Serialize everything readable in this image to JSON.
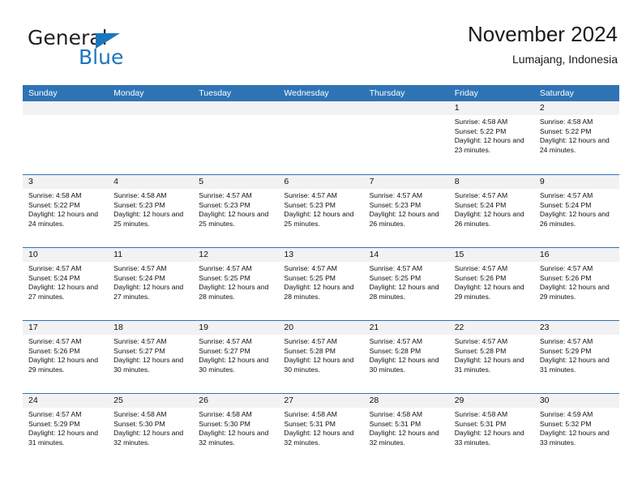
{
  "brand": {
    "name_top": "General",
    "name_bottom": "Blue",
    "triangle_icon": "triangle-icon",
    "color": "#1b76bc"
  },
  "header": {
    "title": "November 2024",
    "location": "Lumajang, Indonesia"
  },
  "theme": {
    "header_blue": "#2e74b5",
    "day_number_bg": "#f2f2f2"
  },
  "weekdays": [
    "Sunday",
    "Monday",
    "Tuesday",
    "Wednesday",
    "Thursday",
    "Friday",
    "Saturday"
  ],
  "labels": {
    "sunrise": "Sunrise:",
    "sunset": "Sunset:",
    "daylight": "Daylight:"
  },
  "weeks": [
    [
      {
        "day": "",
        "empty": true
      },
      {
        "day": "",
        "empty": true
      },
      {
        "day": "",
        "empty": true
      },
      {
        "day": "",
        "empty": true
      },
      {
        "day": "",
        "empty": true
      },
      {
        "day": "1",
        "sunrise": "Sunrise: 4:58 AM",
        "sunset": "Sunset: 5:22 PM",
        "daylight": "Daylight: 12 hours and 23 minutes."
      },
      {
        "day": "2",
        "sunrise": "Sunrise: 4:58 AM",
        "sunset": "Sunset: 5:22 PM",
        "daylight": "Daylight: 12 hours and 24 minutes."
      }
    ],
    [
      {
        "day": "3",
        "sunrise": "Sunrise: 4:58 AM",
        "sunset": "Sunset: 5:22 PM",
        "daylight": "Daylight: 12 hours and 24 minutes."
      },
      {
        "day": "4",
        "sunrise": "Sunrise: 4:58 AM",
        "sunset": "Sunset: 5:23 PM",
        "daylight": "Daylight: 12 hours and 25 minutes."
      },
      {
        "day": "5",
        "sunrise": "Sunrise: 4:57 AM",
        "sunset": "Sunset: 5:23 PM",
        "daylight": "Daylight: 12 hours and 25 minutes."
      },
      {
        "day": "6",
        "sunrise": "Sunrise: 4:57 AM",
        "sunset": "Sunset: 5:23 PM",
        "daylight": "Daylight: 12 hours and 25 minutes."
      },
      {
        "day": "7",
        "sunrise": "Sunrise: 4:57 AM",
        "sunset": "Sunset: 5:23 PM",
        "daylight": "Daylight: 12 hours and 26 minutes."
      },
      {
        "day": "8",
        "sunrise": "Sunrise: 4:57 AM",
        "sunset": "Sunset: 5:24 PM",
        "daylight": "Daylight: 12 hours and 26 minutes."
      },
      {
        "day": "9",
        "sunrise": "Sunrise: 4:57 AM",
        "sunset": "Sunset: 5:24 PM",
        "daylight": "Daylight: 12 hours and 26 minutes."
      }
    ],
    [
      {
        "day": "10",
        "sunrise": "Sunrise: 4:57 AM",
        "sunset": "Sunset: 5:24 PM",
        "daylight": "Daylight: 12 hours and 27 minutes."
      },
      {
        "day": "11",
        "sunrise": "Sunrise: 4:57 AM",
        "sunset": "Sunset: 5:24 PM",
        "daylight": "Daylight: 12 hours and 27 minutes."
      },
      {
        "day": "12",
        "sunrise": "Sunrise: 4:57 AM",
        "sunset": "Sunset: 5:25 PM",
        "daylight": "Daylight: 12 hours and 28 minutes."
      },
      {
        "day": "13",
        "sunrise": "Sunrise: 4:57 AM",
        "sunset": "Sunset: 5:25 PM",
        "daylight": "Daylight: 12 hours and 28 minutes."
      },
      {
        "day": "14",
        "sunrise": "Sunrise: 4:57 AM",
        "sunset": "Sunset: 5:25 PM",
        "daylight": "Daylight: 12 hours and 28 minutes."
      },
      {
        "day": "15",
        "sunrise": "Sunrise: 4:57 AM",
        "sunset": "Sunset: 5:26 PM",
        "daylight": "Daylight: 12 hours and 29 minutes."
      },
      {
        "day": "16",
        "sunrise": "Sunrise: 4:57 AM",
        "sunset": "Sunset: 5:26 PM",
        "daylight": "Daylight: 12 hours and 29 minutes."
      }
    ],
    [
      {
        "day": "17",
        "sunrise": "Sunrise: 4:57 AM",
        "sunset": "Sunset: 5:26 PM",
        "daylight": "Daylight: 12 hours and 29 minutes."
      },
      {
        "day": "18",
        "sunrise": "Sunrise: 4:57 AM",
        "sunset": "Sunset: 5:27 PM",
        "daylight": "Daylight: 12 hours and 30 minutes."
      },
      {
        "day": "19",
        "sunrise": "Sunrise: 4:57 AM",
        "sunset": "Sunset: 5:27 PM",
        "daylight": "Daylight: 12 hours and 30 minutes."
      },
      {
        "day": "20",
        "sunrise": "Sunrise: 4:57 AM",
        "sunset": "Sunset: 5:28 PM",
        "daylight": "Daylight: 12 hours and 30 minutes."
      },
      {
        "day": "21",
        "sunrise": "Sunrise: 4:57 AM",
        "sunset": "Sunset: 5:28 PM",
        "daylight": "Daylight: 12 hours and 30 minutes."
      },
      {
        "day": "22",
        "sunrise": "Sunrise: 4:57 AM",
        "sunset": "Sunset: 5:28 PM",
        "daylight": "Daylight: 12 hours and 31 minutes."
      },
      {
        "day": "23",
        "sunrise": "Sunrise: 4:57 AM",
        "sunset": "Sunset: 5:29 PM",
        "daylight": "Daylight: 12 hours and 31 minutes."
      }
    ],
    [
      {
        "day": "24",
        "sunrise": "Sunrise: 4:57 AM",
        "sunset": "Sunset: 5:29 PM",
        "daylight": "Daylight: 12 hours and 31 minutes."
      },
      {
        "day": "25",
        "sunrise": "Sunrise: 4:58 AM",
        "sunset": "Sunset: 5:30 PM",
        "daylight": "Daylight: 12 hours and 32 minutes."
      },
      {
        "day": "26",
        "sunrise": "Sunrise: 4:58 AM",
        "sunset": "Sunset: 5:30 PM",
        "daylight": "Daylight: 12 hours and 32 minutes."
      },
      {
        "day": "27",
        "sunrise": "Sunrise: 4:58 AM",
        "sunset": "Sunset: 5:31 PM",
        "daylight": "Daylight: 12 hours and 32 minutes."
      },
      {
        "day": "28",
        "sunrise": "Sunrise: 4:58 AM",
        "sunset": "Sunset: 5:31 PM",
        "daylight": "Daylight: 12 hours and 32 minutes."
      },
      {
        "day": "29",
        "sunrise": "Sunrise: 4:58 AM",
        "sunset": "Sunset: 5:31 PM",
        "daylight": "Daylight: 12 hours and 33 minutes."
      },
      {
        "day": "30",
        "sunrise": "Sunrise: 4:59 AM",
        "sunset": "Sunset: 5:32 PM",
        "daylight": "Daylight: 12 hours and 33 minutes."
      }
    ]
  ]
}
